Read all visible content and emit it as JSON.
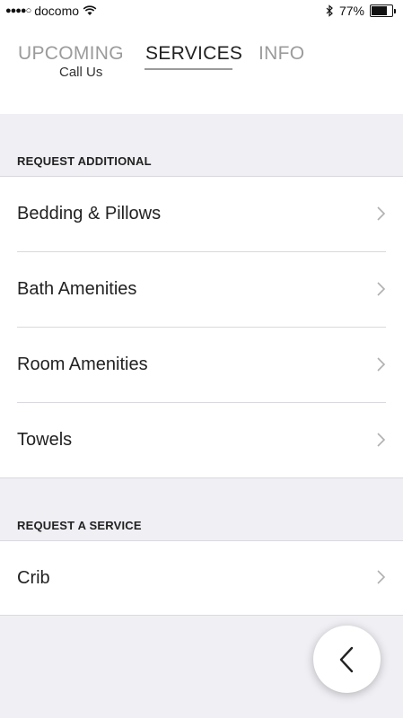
{
  "status_bar": {
    "carrier": "docomo",
    "signal": "●●●●○",
    "battery_percent": "77%",
    "battery_level": 0.77
  },
  "tabs": [
    {
      "label": "UPCOMING",
      "active": false
    },
    {
      "label": "SERVICES",
      "active": true
    },
    {
      "label": "INFO",
      "active": false
    }
  ],
  "clipped_item": "Call Us",
  "sections": [
    {
      "title": "REQUEST ADDITIONAL",
      "items": [
        "Bedding & Pillows",
        "Bath Amenities",
        "Room Amenities",
        "Towels"
      ]
    },
    {
      "title": "REQUEST A SERVICE",
      "items": [
        "Crib"
      ]
    }
  ],
  "fab": {
    "icon": "chevron-left-icon"
  },
  "colors": {
    "background": "#efeff4",
    "divider": "#d9d9de",
    "inactive_tab": "#9b9b9b"
  }
}
